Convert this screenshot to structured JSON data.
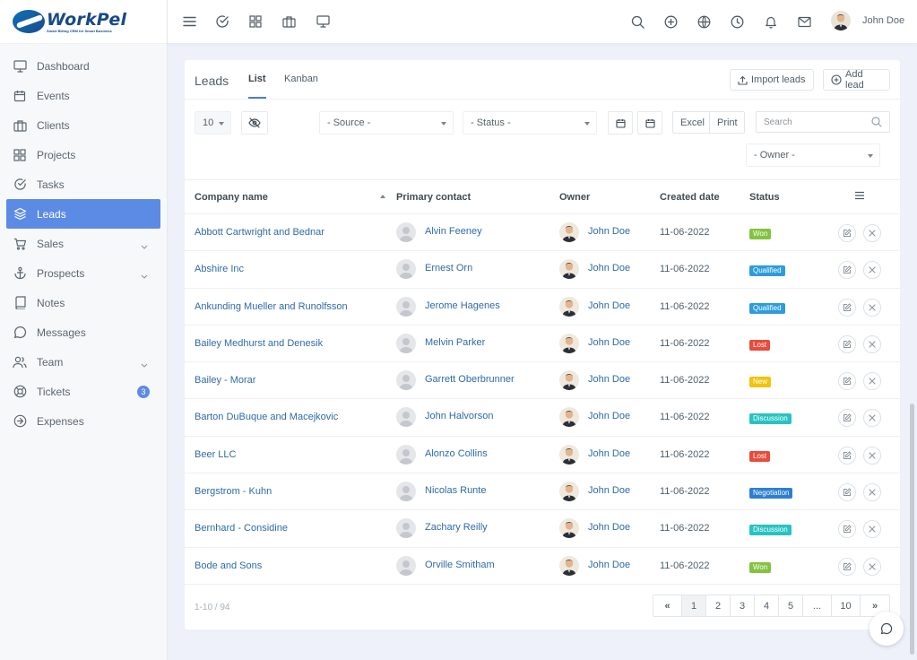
{
  "brand": {
    "name": "WorkPel",
    "tagline": "Smart Billing CRM for Smart Business"
  },
  "sidebar": {
    "items": [
      {
        "label": "Dashboard",
        "icon": "monitor-icon"
      },
      {
        "label": "Events",
        "icon": "calendar-icon"
      },
      {
        "label": "Clients",
        "icon": "briefcase-icon"
      },
      {
        "label": "Projects",
        "icon": "grid-icon"
      },
      {
        "label": "Tasks",
        "icon": "check-circle-icon"
      },
      {
        "label": "Leads",
        "icon": "layers-icon",
        "active": true
      },
      {
        "label": "Sales",
        "icon": "cart-icon",
        "has_children": true
      },
      {
        "label": "Prospects",
        "icon": "anchor-icon",
        "has_children": true
      },
      {
        "label": "Notes",
        "icon": "book-icon"
      },
      {
        "label": "Messages",
        "icon": "message-circle-icon"
      },
      {
        "label": "Team",
        "icon": "users-icon",
        "has_children": true
      },
      {
        "label": "Tickets",
        "icon": "lifebuoy-icon",
        "badge": "3"
      },
      {
        "label": "Expenses",
        "icon": "arrow-circle-icon"
      }
    ]
  },
  "topbar": {
    "user_name": "John Doe"
  },
  "page": {
    "title": "Leads",
    "tabs": [
      "List",
      "Kanban"
    ],
    "active_tab": "List",
    "import_label": "Import leads",
    "add_label": "Add lead"
  },
  "filters": {
    "page_size": "10",
    "source": "- Source -",
    "status": "- Status -",
    "owner": "- Owner -",
    "excel_label": "Excel",
    "print_label": "Print",
    "search_placeholder": "Search"
  },
  "table": {
    "headers": {
      "company": "Company name",
      "contact": "Primary contact",
      "owner": "Owner",
      "created": "Created date",
      "status": "Status"
    },
    "rows": [
      {
        "company": "Abbott Cartwright and Bednar",
        "contact": "Alvin Feeney",
        "owner": "John Doe",
        "date": "11-06-2022",
        "status": "Won"
      },
      {
        "company": "Abshire Inc",
        "contact": "Ernest Orn",
        "owner": "John Doe",
        "date": "11-06-2022",
        "status": "Qualified"
      },
      {
        "company": "Ankunding Mueller and Runolfsson",
        "contact": "Jerome Hagenes",
        "owner": "John Doe",
        "date": "11-06-2022",
        "status": "Qualified"
      },
      {
        "company": "Bailey Medhurst and Denesik",
        "contact": "Melvin Parker",
        "owner": "John Doe",
        "date": "11-06-2022",
        "status": "Lost"
      },
      {
        "company": "Bailey - Morar",
        "contact": "Garrett Oberbrunner",
        "owner": "John Doe",
        "date": "11-06-2022",
        "status": "New"
      },
      {
        "company": "Barton DuBuque and Macejkovic",
        "contact": "John Halvorson",
        "owner": "John Doe",
        "date": "11-06-2022",
        "status": "Discussion"
      },
      {
        "company": "Beer LLC",
        "contact": "Alonzo Collins",
        "owner": "John Doe",
        "date": "11-06-2022",
        "status": "Lost"
      },
      {
        "company": "Bergstrom - Kuhn",
        "contact": "Nicolas Runte",
        "owner": "John Doe",
        "date": "11-06-2022",
        "status": "Negotiation"
      },
      {
        "company": "Bernhard - Considine",
        "contact": "Zachary Reilly",
        "owner": "John Doe",
        "date": "11-06-2022",
        "status": "Discussion"
      },
      {
        "company": "Bode and Sons",
        "contact": "Orville Smitham",
        "owner": "John Doe",
        "date": "11-06-2022",
        "status": "Won"
      }
    ]
  },
  "status_colors": {
    "Won": "#83c340",
    "Qualified": "#2d9cdb",
    "Lost": "#e74c3c",
    "New": "#f1c40f",
    "Discussion": "#29c2c2",
    "Negotiation": "#2d7fd3"
  },
  "pagination": {
    "range": "1-10 / 94",
    "pages": [
      "«",
      "1",
      "2",
      "3",
      "4",
      "5",
      "...",
      "10",
      "»"
    ],
    "active": "1"
  }
}
